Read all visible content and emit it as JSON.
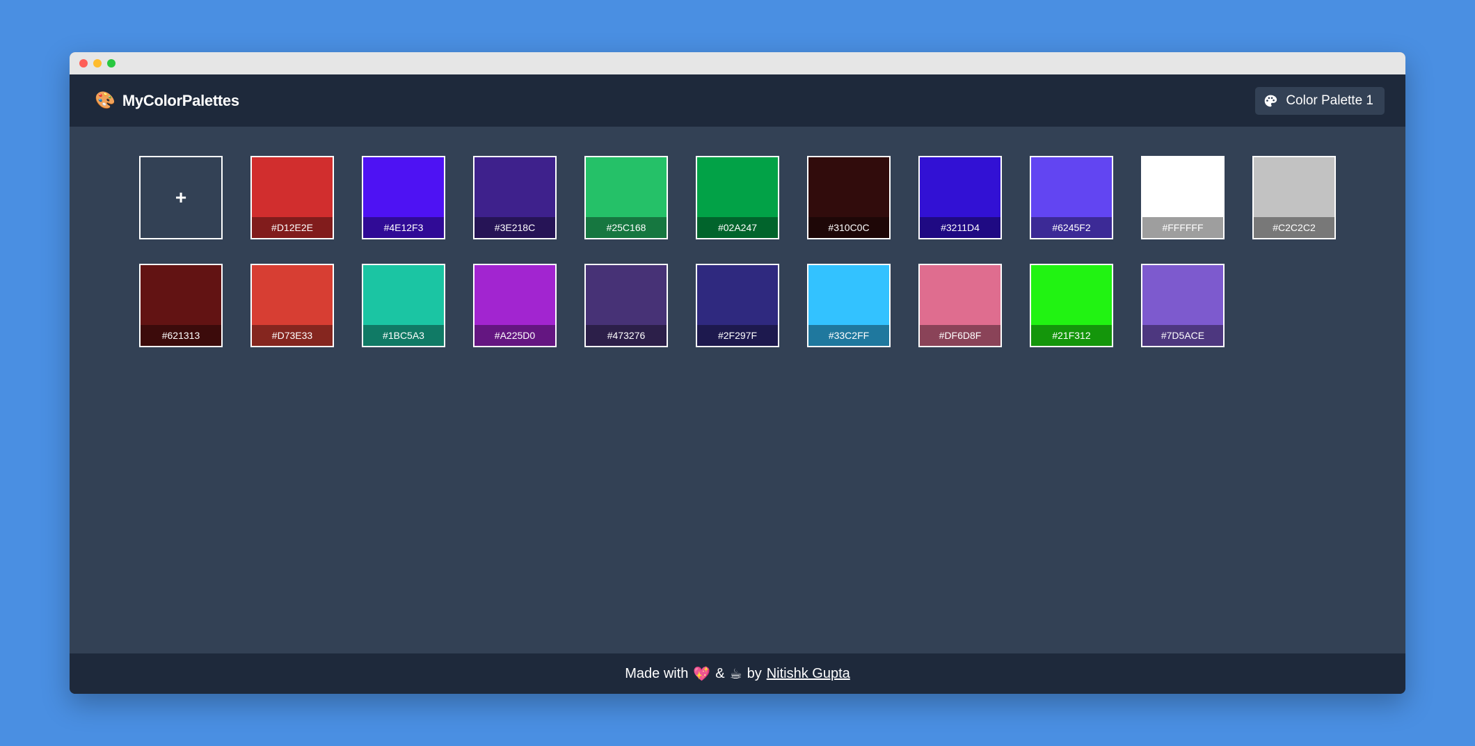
{
  "app": {
    "brand_icon": "🎨",
    "title": "MyColorPalettes"
  },
  "header": {
    "palette_button_icon": "palette-icon",
    "palette_button_label": "Color Palette 1"
  },
  "palette": {
    "add_label": "+",
    "colors": [
      "#D12E2E",
      "#4E12F3",
      "#3E218C",
      "#25C168",
      "#02A247",
      "#310C0C",
      "#3211D4",
      "#6245F2",
      "#FFFFFF",
      "#C2C2C2",
      "#621313",
      "#D73E33",
      "#1BC5A3",
      "#A225D0",
      "#473276",
      "#2F297F",
      "#33C2FF",
      "#DF6D8F",
      "#21F312",
      "#7D5ACE"
    ]
  },
  "footer": {
    "made_with": "Made with",
    "heart_icon": "💖",
    "ampersand": "&",
    "coffee_icon": "☕",
    "by": "by",
    "author": "Nitishk Gupta"
  }
}
